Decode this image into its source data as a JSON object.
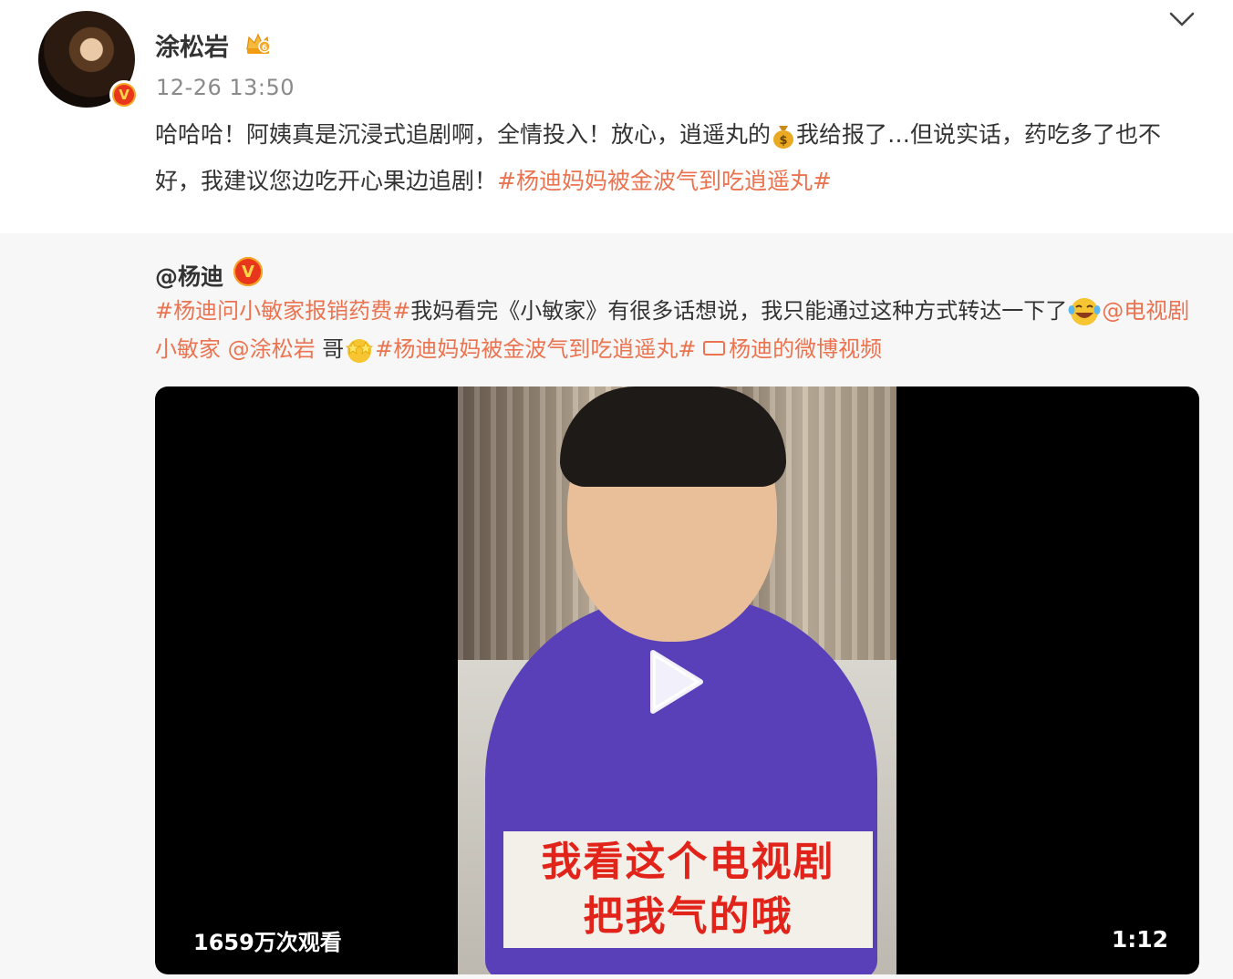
{
  "post": {
    "author": "涂松岩",
    "timestamp": "12-26 13:50",
    "text_part1": "哈哈哈！阿姨真是沉浸式追剧啊，全情投入！放心，逍遥丸的",
    "text_part2": "我给报了…但说实话，药吃多了也不好，我建议您边吃开心果边追剧！",
    "hashtag": "#杨迪妈妈被金波气到吃逍遥丸#",
    "emoji_money": "money-bag-icon"
  },
  "repost": {
    "author": "@杨迪",
    "hashtag1": "#杨迪问小敏家报销药费#",
    "text1": "我妈看完《小敏家》有很多话想说，我只能通过这种方式转达一下了",
    "mention1": "@电视剧小敏家",
    "mention2": "@涂松岩",
    "text2": "哥",
    "hashtag2": "#杨迪妈妈被金波气到吃逍遥丸#",
    "video_link": "杨迪的微博视频",
    "video": {
      "subtitle_line1": "我看这个电视剧",
      "subtitle_line2": "把我气的哦",
      "views": "1659万次观看",
      "duration": "1:12"
    }
  },
  "colors": {
    "link": "#eb7350",
    "text": "#333333",
    "meta": "#8a8a8a",
    "repost_bg": "#f7f7f7",
    "subtitle_red": "#e2231a"
  }
}
